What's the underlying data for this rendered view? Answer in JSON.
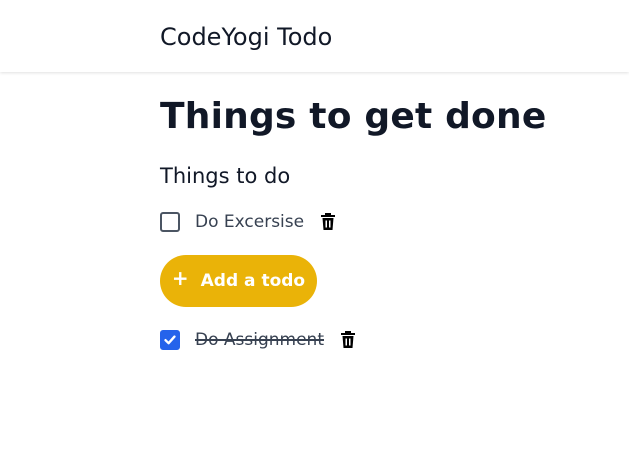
{
  "header": {
    "app_title": "CodeYogi Todo"
  },
  "main": {
    "page_title": "Things to get done",
    "todo_section_title": "Things to do",
    "todos": [
      {
        "label": "Do Excersise",
        "checked": false
      }
    ],
    "add_button_label": "Add a todo",
    "add_button_icon": "+",
    "done": [
      {
        "label": "Do Assignment",
        "checked": true
      }
    ]
  },
  "colors": {
    "accent": "#eab308",
    "checkbox_checked": "#2563eb",
    "text": "#111827"
  },
  "icons": {
    "delete": "trash-icon",
    "add": "plus-icon",
    "check": "check-icon"
  }
}
